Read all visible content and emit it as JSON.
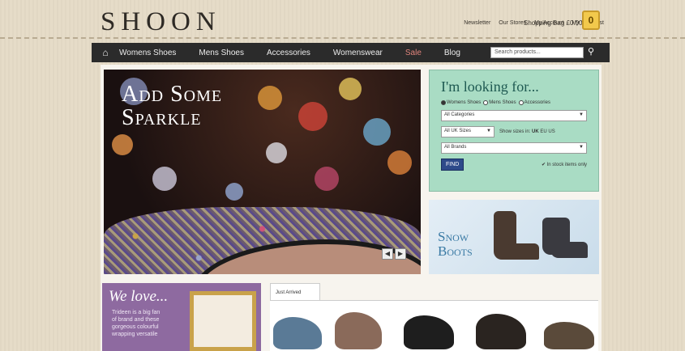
{
  "header": {
    "logo": "SHOON",
    "links": [
      "Newsletter",
      "Our Stores",
      "My Account",
      "My Wish List"
    ],
    "bag_label": "Shopping Bag £0.00",
    "bag_count": "0"
  },
  "nav": {
    "items": [
      "Womens Shoes",
      "Mens Shoes",
      "Accessories",
      "Womenswear",
      "Sale",
      "Blog"
    ],
    "search_placeholder": "Search products..."
  },
  "hero": {
    "title_line1": "Add Some",
    "title_line2": "Sparkle",
    "prev": "◀",
    "next": "▶"
  },
  "finder": {
    "title": "I'm looking for...",
    "radios": [
      "Womens Shoes",
      "Mens Shoes",
      "Accessories"
    ],
    "category": "All Categories",
    "sizes": "All UK Sizes",
    "sizes_label": "Show sizes in:",
    "size_units": [
      "UK",
      "EU",
      "US"
    ],
    "brands": "All Brands",
    "find_button": "FIND",
    "instock": "In stock items only"
  },
  "promo": {
    "snow_line1": "Snow",
    "snow_line2": "Boots"
  },
  "bottom": {
    "welove_title": "We love...",
    "welove_text": "Trideen is a big fan of brand and these gorgeous colourful wrapping versatile",
    "tab_label": "Just Arrived"
  }
}
